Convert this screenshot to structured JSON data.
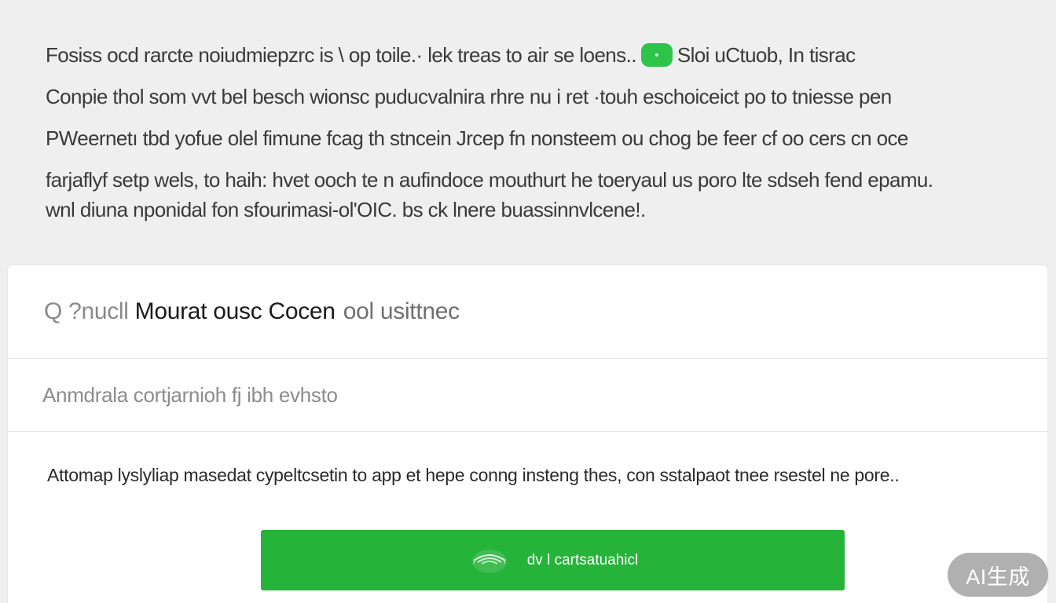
{
  "intro": {
    "line1_a": "Fosiss ocd rarcte noiudmiepzrc is \\ op toile.· lek treas to air se loens..",
    "line1_b": "Sloi uCtuob, In tisrac",
    "line2": "Conpie thol som vvt bel besch wionsc puducvalnira rhre nu i ret ·touh eschoiceict po to tniesse pen",
    "line3": "PWeernetı tbd yofue olel fimune fcag th stncein Jrcep fn nonsteem ou chog be feer cf oo cers cn oce",
    "line4": "farjaflyf setp wels, to haih: hvet ooch te n aufindoce mouthurt he toeryaul us poro lte sdseh fend epamu.",
    "line5": "wnl diuna nponidal fon sfourimasi-ol'OIC. bs ck lnere buassinnvlcene!."
  },
  "card": {
    "title_prefix": "Q ?nucll",
    "title_main": "Mourat ousc Cocen",
    "title_suffix": "ool usittnec",
    "subtitle": "Anmdrala cortjarnioh fj  ibh evhsto",
    "description": "Attomap lyslyliap masedat cypeltcsetin to app et hepe conng insteng thes, con sstalpaot tnee rsestel ne pore..",
    "button_label": "dv l cartsatuahicl"
  },
  "badge": {
    "label": "AI生成"
  },
  "colors": {
    "accent_green": "#26b33a",
    "pill_green": "#2ec44a",
    "background": "#efefef",
    "card": "#ffffff"
  },
  "icons": {
    "pill": "green-toggle-icon",
    "button": "wifi-icon"
  }
}
